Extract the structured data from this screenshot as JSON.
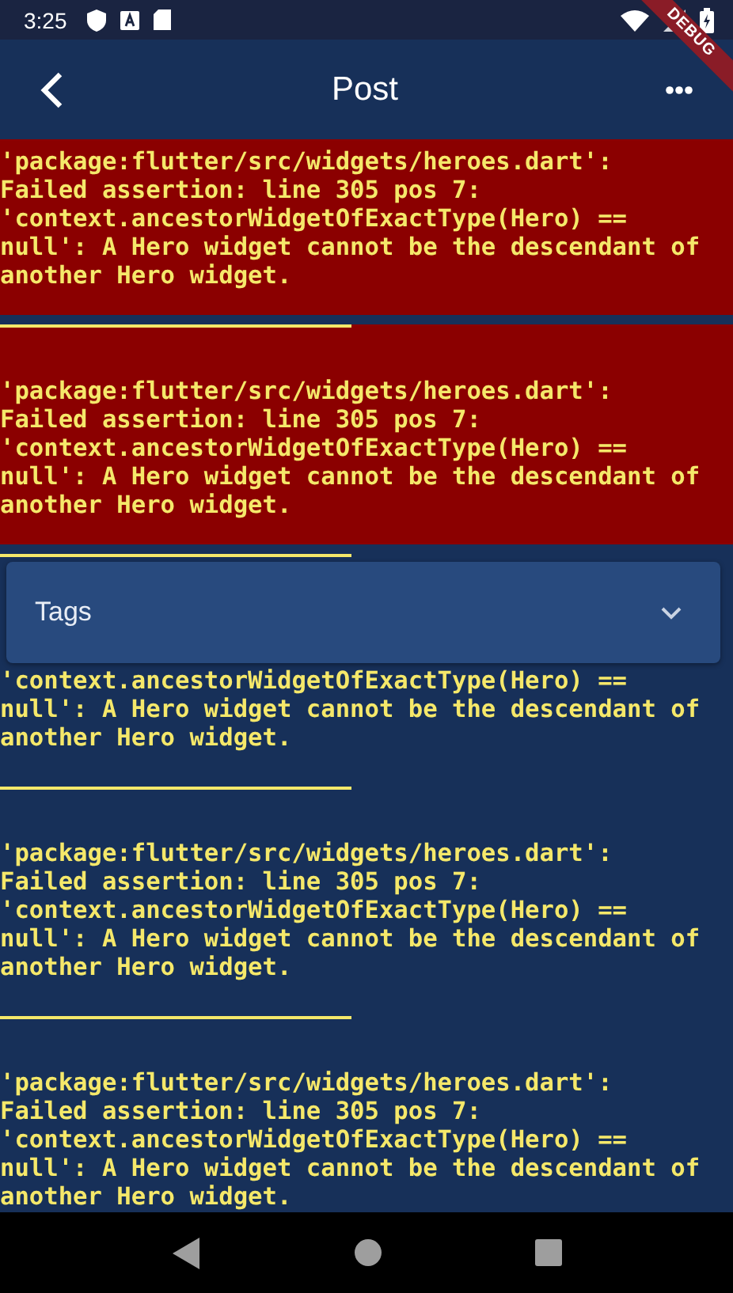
{
  "status_bar": {
    "time": "3:25"
  },
  "debug_banner": {
    "label": "DEBUG"
  },
  "app_bar": {
    "title": "Post"
  },
  "messages": [
    {
      "highlighted": true,
      "lines": [
        "'package:flutter/src/widgets/heroes.dart':",
        "Failed assertion: line 305 pos 7:",
        "'context.ancestorWidgetOfExactType(Hero) ==",
        "null': A Hero widget cannot be the descendant of",
        "another Hero widget."
      ]
    },
    {
      "highlighted": true,
      "lines": [
        "'package:flutter/src/widgets/heroes.dart':",
        "Failed assertion: line 305 pos 7:",
        "'context.ancestorWidgetOfExactType(Hero) ==",
        "null': A Hero widget cannot be the descendant of",
        "another Hero widget."
      ]
    },
    {
      "highlighted": false,
      "lines": [
        "'context.ancestorWidgetOfExactType(Hero) ==",
        "null': A Hero widget cannot be the descendant of",
        "another Hero widget."
      ]
    },
    {
      "highlighted": false,
      "lines": [
        "'package:flutter/src/widgets/heroes.dart':",
        "Failed assertion: line 305 pos 7:",
        "'context.ancestorWidgetOfExactType(Hero) ==",
        "null': A Hero widget cannot be the descendant of",
        "another Hero widget."
      ]
    },
    {
      "highlighted": false,
      "lines": [
        "'package:flutter/src/widgets/heroes.dart':",
        "Failed assertion: line 305 pos 7:",
        "'context.ancestorWidgetOfExactType(Hero) ==",
        "null': A Hero widget cannot be the descendant of",
        "another Hero widget."
      ]
    }
  ],
  "tags_dropdown": {
    "label": "Tags"
  }
}
